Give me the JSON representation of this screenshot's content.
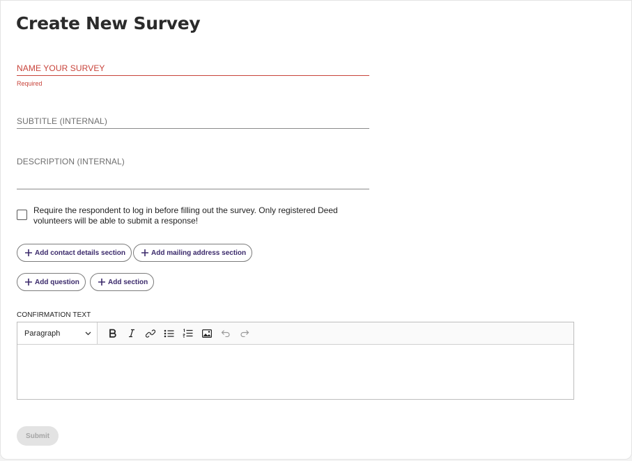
{
  "page": {
    "title": "Create New Survey"
  },
  "form": {
    "name_label": "NAME YOUR SURVEY",
    "name_helper": "Required",
    "subtitle_label": "SUBTITLE (INTERNAL)",
    "description_label": "DESCRIPTION (INTERNAL)",
    "require_login_text": "Require the respondent to log in before filling out the survey. Only registered Deed volunteers will be able to submit a response!",
    "require_login_checked": false
  },
  "actions": {
    "add_contact": "Add contact details section",
    "add_mailing": "Add mailing address section",
    "add_question": "Add question",
    "add_section": "Add section"
  },
  "confirmation": {
    "label": "CONFIRMATION TEXT",
    "block_format": "Paragraph",
    "toolbar": [
      "bold-icon",
      "italic-icon",
      "link-icon",
      "bulleted-list-icon",
      "numbered-list-icon",
      "image-icon",
      "undo-icon",
      "redo-icon"
    ]
  },
  "submit_label": "Submit",
  "colors": {
    "error": "#c8433a",
    "accent": "#3b2a6b",
    "disabled_bg": "#e3e3e3"
  }
}
